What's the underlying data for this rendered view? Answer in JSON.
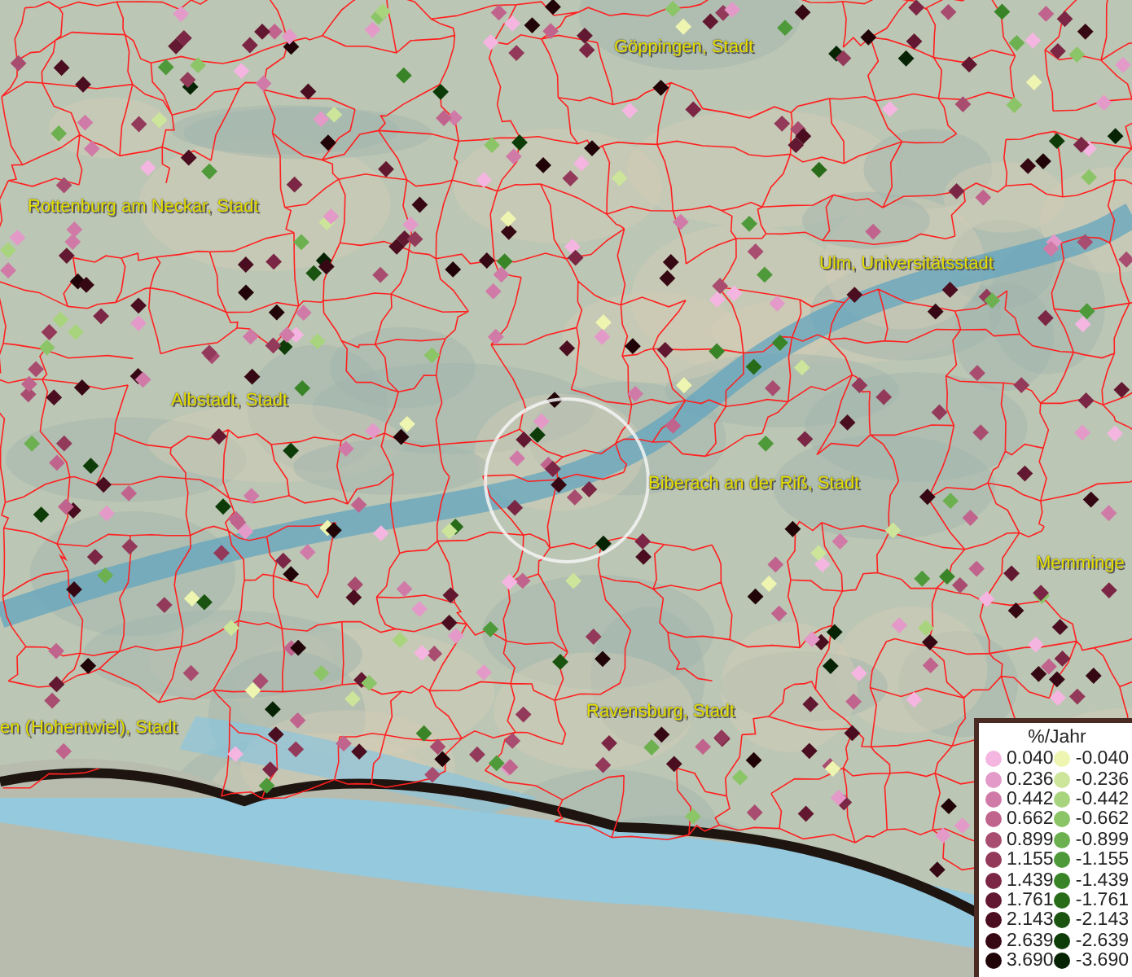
{
  "map": {
    "places": [
      {
        "name": "Göppingen, Stadt"
      },
      {
        "name": "Rottenburg am Neckar, Stadt"
      },
      {
        "name": "Ulm, Universitätsstadt"
      },
      {
        "name": "Albstadt, Stadt"
      },
      {
        "name": "Biberach an der Riß, Stadt"
      },
      {
        "name": "Memminge"
      },
      {
        "name": "en (Hohentwiel), Stadt"
      },
      {
        "name": "Ravensburg, Stadt"
      }
    ]
  },
  "legend": {
    "title": "%/Jahr",
    "positive": [
      {
        "label": "0.040",
        "color": "#f4b6e0"
      },
      {
        "label": "0.236",
        "color": "#e39ac8"
      },
      {
        "label": "0.442",
        "color": "#d07aa8"
      },
      {
        "label": "0.662",
        "color": "#c0648e"
      },
      {
        "label": "0.899",
        "color": "#a84c70"
      },
      {
        "label": "1.155",
        "color": "#93395a"
      },
      {
        "label": "1.439",
        "color": "#7a2644"
      },
      {
        "label": "1.761",
        "color": "#621830"
      },
      {
        "label": "2.143",
        "color": "#4a0e20"
      },
      {
        "label": "2.639",
        "color": "#360814"
      },
      {
        "label": "3.690",
        "color": "#200408"
      }
    ],
    "negative": [
      {
        "label": "-0.040",
        "color": "#eef5b0"
      },
      {
        "label": "-0.236",
        "color": "#cce59a"
      },
      {
        "label": "-0.442",
        "color": "#a8d47e"
      },
      {
        "label": "-0.662",
        "color": "#8cc468"
      },
      {
        "label": "-0.899",
        "color": "#6cb050"
      },
      {
        "label": "-1.155",
        "color": "#4e9a3a"
      },
      {
        "label": "-1.439",
        "color": "#3a8428"
      },
      {
        "label": "-1.761",
        "color": "#286c1a"
      },
      {
        "label": "-2.143",
        "color": "#1a5410"
      },
      {
        "label": "-2.639",
        "color": "#0e3c08"
      },
      {
        "label": "-3.690",
        "color": "#062404"
      }
    ]
  }
}
